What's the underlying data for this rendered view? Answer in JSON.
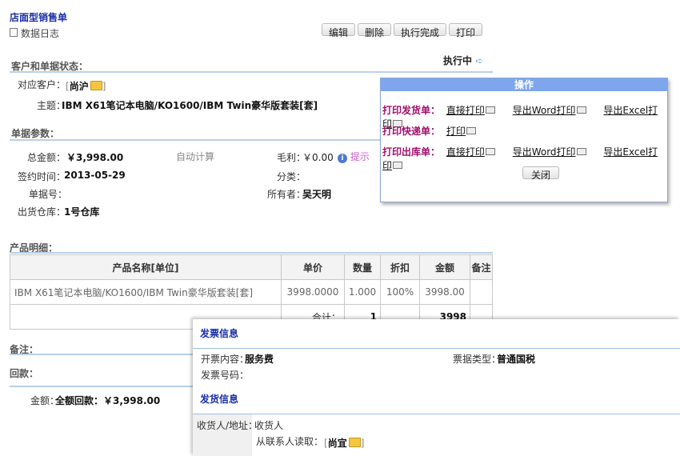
{
  "page": {
    "title": "店面型销售单",
    "data_log": "数据日志"
  },
  "toolbar": {
    "edit": "编辑",
    "delete": "删除",
    "complete": "执行完成",
    "print": "打印"
  },
  "status": "执行中",
  "customer_section": {
    "heading": "客户和单据状态：",
    "customer_label": "对应客户：",
    "customer_value": "尚沪",
    "subject_label": "主题：",
    "subject_value": "IBM X61笔记本电脑/KO1600/IBM Twin豪华版套装[套]"
  },
  "params_section": {
    "heading": "单据参数：",
    "total_label": "总金额：",
    "total_value": "￥3,998.00",
    "auto_calc": "自动计算",
    "profit_label": "毛利：",
    "profit_value": "￥0.00",
    "tip": "提示",
    "sign_label": "签约时间：",
    "sign_value": "2013-05-29",
    "category_label": "分类：",
    "number_label": "单据号：",
    "owner_label": "所有者：",
    "owner_value": "吴天明",
    "warehouse_label": "出货仓库：",
    "warehouse_value": "1号仓库"
  },
  "products": {
    "heading": "产品明细：",
    "columns": [
      "产品名称[单位]",
      "单价",
      "数量",
      "折扣",
      "金额",
      "备注"
    ],
    "rows": [
      {
        "name": "IBM X61笔记本电脑/KO1600/IBM Twin豪华版套装[套]",
        "price": "3998.0000",
        "qty": "1.000",
        "discount": "100%",
        "amount": "3998.00",
        "note": ""
      }
    ],
    "total_label": "合计：",
    "total_qty": "1",
    "total_amount": "3998"
  },
  "remarks": {
    "heading": "备注："
  },
  "payment": {
    "heading": "回款：",
    "amount_label": "金额：",
    "amount_value": "全额回款：￥3,998.00"
  },
  "popup": {
    "title": "操作",
    "print_invoice_label": "打印发货单：",
    "print_express_label": "打印快递单：",
    "print_outbound_label": "打印出库单：",
    "direct_print": "直接打印",
    "word_print": "导出Word打印",
    "excel_print": "导出Excel打印",
    "print": "打印",
    "close": "关闭"
  },
  "panel": {
    "invoice_heading": "发票信息",
    "content_label": "开票内容：",
    "content_value": "服务费",
    "type_label": "票据类型：",
    "type_value": "普通国税",
    "number_label": "发票号码：",
    "shipping_heading": "发货信息",
    "receiver_label": "收货人/地址：",
    "receiver_value": "收货人",
    "read_label": "从联系人读取：",
    "read_value": "尚宜"
  }
}
